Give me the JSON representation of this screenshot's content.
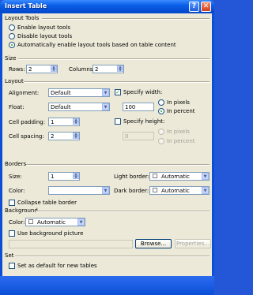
{
  "window": {
    "title": "Insert Table",
    "help_glyph": "?",
    "close_glyph": "✕"
  },
  "layout_tools": {
    "section": "Layout Tools",
    "options": [
      {
        "label": "Enable layout tools",
        "selected": false
      },
      {
        "label": "Disable layout tools",
        "selected": false
      },
      {
        "label": "Automatically enable layout tools based on table content",
        "selected": true
      }
    ]
  },
  "size": {
    "section": "Size",
    "rows_label": "Rows:",
    "rows_value": "2",
    "columns_label": "Columns:",
    "columns_value": "2"
  },
  "layout": {
    "section": "Layout",
    "alignment_label": "Alignment:",
    "alignment_value": "Default",
    "float_label": "Float:",
    "float_value": "Default",
    "cell_padding_label": "Cell padding:",
    "cell_padding_value": "1",
    "cell_spacing_label": "Cell spacing:",
    "cell_spacing_value": "2",
    "specify_width_label": "Specify width:",
    "specify_width_checked": true,
    "width_value": "100",
    "width_in_pixels": "In pixels",
    "width_in_percent": "In percent",
    "width_unit": "percent",
    "specify_height_label": "Specify height:",
    "specify_height_checked": false,
    "height_value": "0",
    "height_in_pixels": "In pixels",
    "height_in_percent": "In percent"
  },
  "borders": {
    "section": "Borders",
    "size_label": "Size:",
    "size_value": "1",
    "color_label": "Color:",
    "color_value": "",
    "collapse_label": "Collapse table border",
    "collapse_checked": false,
    "light_border_label": "Light border:",
    "light_border_value": "Automatic",
    "dark_border_label": "Dark border:",
    "dark_border_value": "Automatic"
  },
  "background": {
    "section": "Background",
    "color_label": "Color:",
    "color_value": "Automatic",
    "use_picture_label": "Use background picture",
    "use_picture_checked": false,
    "picture_path": "",
    "browse_label": "Browse...",
    "properties_label": "Properties..."
  },
  "set": {
    "section": "Set",
    "default_label": "Set as default for new tables",
    "default_checked": false
  },
  "colors": {
    "title_bar": "#0a5ee8",
    "dialog_bg": "#ece9d8",
    "check_green": "#21a121",
    "close_red": "#d3411b"
  }
}
